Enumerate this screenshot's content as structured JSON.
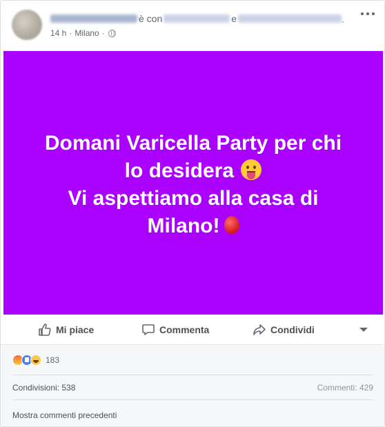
{
  "header": {
    "with_text": "è con",
    "and_text": "e",
    "end_dot": ".",
    "time": "14 h",
    "location": "Milano",
    "meta_sep": "·"
  },
  "post": {
    "background": "#aa00ff",
    "line1": "Domani Varicella Party per chi",
    "line2": "lo desidera",
    "line3": "Vi aspettiamo alla casa di",
    "line4": "Milano!",
    "emoji1": "face-with-tongue-icon",
    "emoji2": "balloon-icon"
  },
  "actions": {
    "like": "Mi piace",
    "comment": "Commenta",
    "share": "Condividi"
  },
  "footer": {
    "reaction_count": "183",
    "shares": "Condivisioni: 538",
    "comments": "Commenti: 429",
    "more_comments": "Mostra commenti precedenti"
  }
}
